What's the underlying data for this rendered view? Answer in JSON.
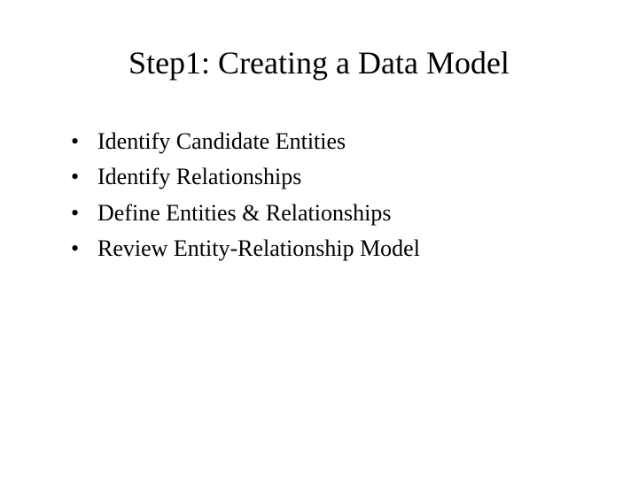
{
  "slide": {
    "title": "Step1: Creating a Data Model",
    "bullets": [
      "Identify Candidate Entities",
      "Identify Relationships",
      "Define Entities & Relationships",
      "Review Entity-Relationship Model"
    ]
  }
}
